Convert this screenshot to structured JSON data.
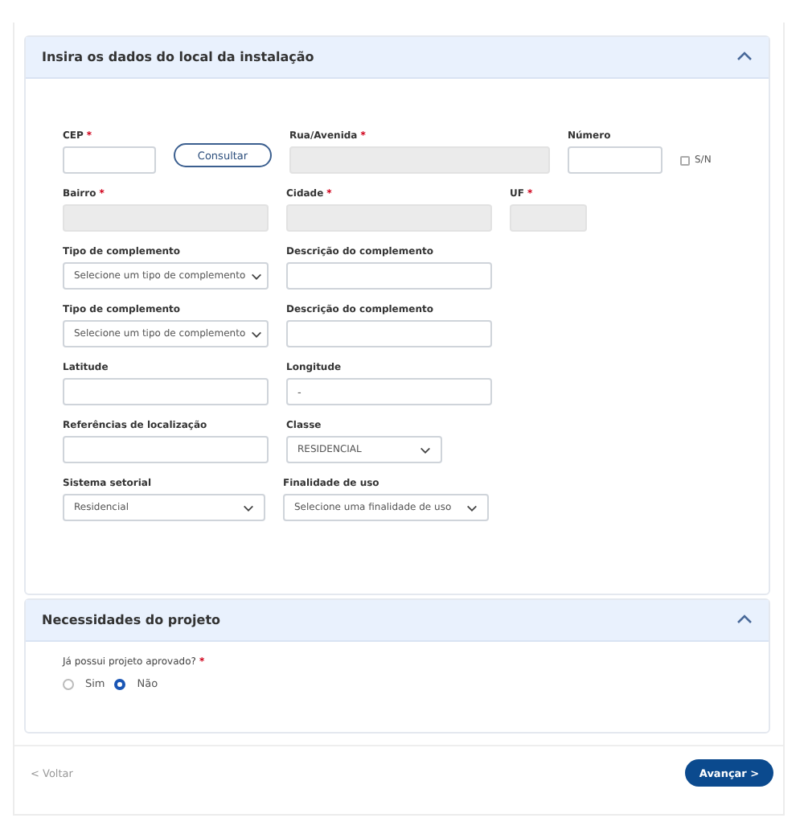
{
  "sections": [
    {
      "title": "Insira os dados do local da instalação",
      "expanded": true,
      "kind": "form",
      "rows": [
        {
          "fields": [
            {
              "kind": "text",
              "label": "CEP",
              "required_mark": "*"
            },
            {
              "kind": "button",
              "label": "Consultar"
            },
            {
              "kind": "readonly",
              "label": "Rua/Avenida",
              "required_mark": "*"
            },
            {
              "kind": "text",
              "label": "Número"
            },
            {
              "kind": "checkbox",
              "label": "S/N",
              "checked": false
            }
          ]
        },
        {
          "fields": [
            {
              "kind": "readonly",
              "label": "Bairro",
              "required_mark": "*"
            },
            {
              "kind": "readonly",
              "label": "Cidade",
              "required_mark": "*"
            },
            {
              "kind": "readonly",
              "label": "UF",
              "required_mark": "*"
            }
          ]
        },
        {
          "fields": [
            {
              "kind": "select",
              "label": "Tipo de complemento",
              "placeholder": "Selecione um tipo de complemento"
            },
            {
              "kind": "text",
              "label": "Descrição do complemento"
            }
          ]
        },
        {
          "fields": [
            {
              "kind": "select",
              "label": "Tipo de complemento",
              "placeholder": "Selecione um tipo de complemento"
            },
            {
              "kind": "text",
              "label": "Descrição do complemento"
            }
          ]
        },
        {
          "fields": [
            {
              "kind": "text",
              "label": "Latitude"
            },
            {
              "kind": "text",
              "label": "Longitude",
              "value": "-"
            }
          ]
        },
        {
          "fields": [
            {
              "kind": "text",
              "label": "Referências de localização"
            },
            {
              "kind": "select",
              "label": "Classe",
              "value": "RESIDENCIAL"
            }
          ]
        },
        {
          "fields": [
            {
              "kind": "select",
              "label": "Sistema setorial",
              "value": "Residencial"
            },
            {
              "kind": "select",
              "label": "Finalidade de uso",
              "placeholder": "Selecione uma finalidade de uso"
            }
          ]
        }
      ]
    },
    {
      "title": "Necessidades do projeto",
      "expanded": true,
      "kind": "radio",
      "question": "Já possui projeto aprovado?",
      "required_mark": "*",
      "options": [
        {
          "label": "Sim",
          "selected": false
        },
        {
          "label": "Não",
          "selected": true
        }
      ]
    }
  ],
  "footer": {
    "back": "< Voltar",
    "next": "Avançar >"
  }
}
